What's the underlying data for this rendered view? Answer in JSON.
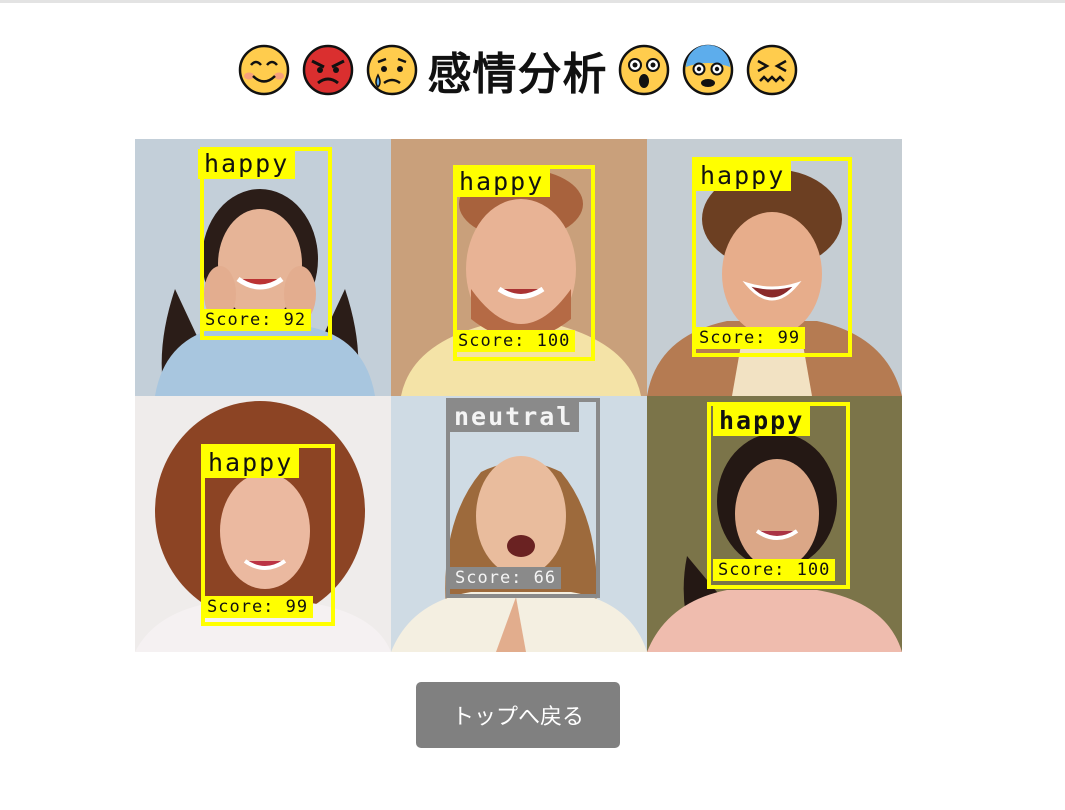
{
  "header": {
    "emojis_left": [
      "smiling-face-emoji",
      "angry-face-emoji",
      "crying-face-emoji"
    ],
    "title": "感情分析",
    "emojis_right": [
      "astonished-face-emoji",
      "fearful-face-emoji",
      "confounded-face-emoji"
    ]
  },
  "results": [
    {
      "emotion": "happy",
      "score_text": "Score: 92",
      "score": 92,
      "color": "#ffff00"
    },
    {
      "emotion": "happy",
      "score_text": "Score: 100",
      "score": 100,
      "color": "#ffff00"
    },
    {
      "emotion": "happy",
      "score_text": "Score: 99",
      "score": 99,
      "color": "#ffff00"
    },
    {
      "emotion": "happy",
      "score_text": "Score: 99",
      "score": 99,
      "color": "#ffff00"
    },
    {
      "emotion": "neutral",
      "score_text": "Score: 66",
      "score": 66,
      "color": "#8a8a8a"
    },
    {
      "emotion": "happy",
      "score_text": "Score: 100",
      "score": 100,
      "color": "#ffff00"
    }
  ],
  "back_button": {
    "label": "トップへ戻る"
  }
}
